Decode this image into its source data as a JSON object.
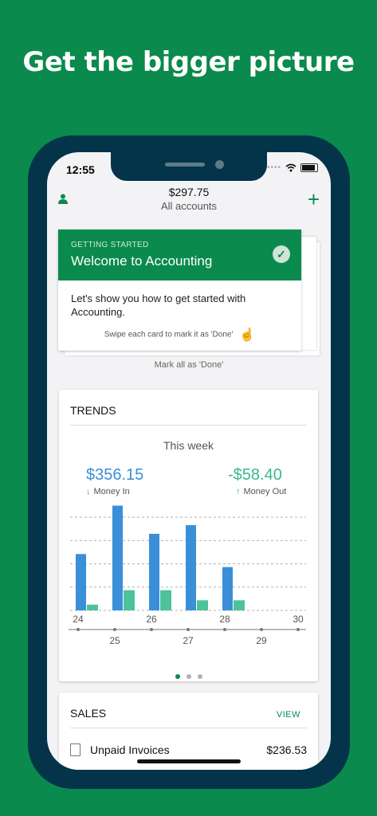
{
  "headline": "Get the bigger picture",
  "status_bar": {
    "time": "12:55",
    "signal_dots": "••••"
  },
  "header": {
    "balance": "$297.75",
    "subtitle": "All accounts"
  },
  "getting_started": {
    "kicker": "GETTING STARTED",
    "title": "Welcome to Accounting",
    "body": "Let's show you how to get started with Accounting.",
    "hint": "Swipe each card to mark it as 'Done'",
    "mark_all": "Mark all as 'Done'"
  },
  "trends": {
    "title": "TRENDS",
    "period": "This week",
    "money_in_value": "$356.15",
    "money_in_label": "Money In",
    "money_out_value": "-$58.40",
    "money_out_label": "Money Out"
  },
  "chart_data": {
    "type": "bar",
    "categories": [
      "24",
      "25",
      "26",
      "27",
      "28",
      "29",
      "30"
    ],
    "series": [
      {
        "name": "Money In",
        "values": [
          78,
          145,
          106,
          118,
          60,
          0,
          0
        ],
        "color": "#3a8fd8"
      },
      {
        "name": "Money Out",
        "values": [
          8,
          28,
          28,
          14,
          14,
          0,
          0
        ],
        "color": "#4cc39a"
      }
    ],
    "grid": true,
    "ylim": [
      0,
      150
    ]
  },
  "pager": {
    "count": 3,
    "active": 0
  },
  "sales": {
    "title": "SALES",
    "view_label": "VIEW",
    "rows": [
      {
        "label": "Unpaid Invoices",
        "amount": "$236.53"
      }
    ]
  },
  "colors": {
    "brand_green": "#0a8a4d",
    "phone_frame": "#04344a",
    "money_in": "#3a8fd8",
    "money_out": "#3ab888"
  }
}
